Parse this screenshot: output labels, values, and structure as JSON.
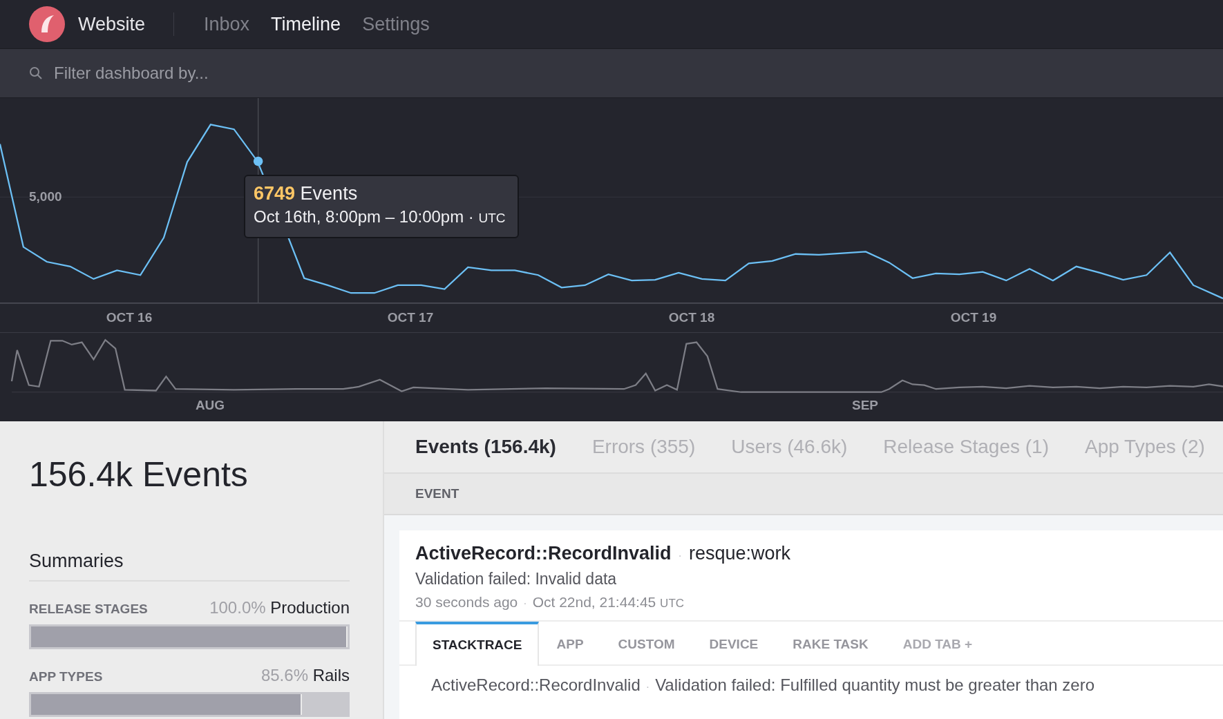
{
  "app_bar": {
    "project": "Website",
    "nav": [
      {
        "label": "Inbox",
        "selected": false
      },
      {
        "label": "Timeline",
        "selected": true
      },
      {
        "label": "Settings",
        "selected": false
      }
    ]
  },
  "filter": {
    "placeholder": "Filter dashboard by..."
  },
  "timeline_chart": {
    "y_label": "5,000",
    "x_labels": [
      "OCT 16",
      "OCT 17",
      "OCT 18",
      "OCT 19"
    ],
    "tooltip": {
      "count": "6749",
      "unit": "Events",
      "range": "Oct 16th, 8:00pm – 10:00pm ·",
      "timezone": "UTC"
    }
  },
  "overview_chart": {
    "x_labels": [
      "AUG",
      "SEP"
    ]
  },
  "summary": {
    "title": "156.4k Events",
    "heading": "Summaries",
    "rows": [
      {
        "label": "RELEASE STAGES",
        "percent": "100.0%",
        "value": "Production",
        "level": 1.0
      },
      {
        "label": "APP TYPES",
        "percent": "85.6%",
        "value": "Rails",
        "level": 0.856
      }
    ]
  },
  "tabs": [
    {
      "label": "Events (156.4k)",
      "selected": true
    },
    {
      "label": "Errors (355)",
      "selected": false
    },
    {
      "label": "Users (46.6k)",
      "selected": false
    },
    {
      "label": "Release Stages (1)",
      "selected": false
    },
    {
      "label": "App Types (2)",
      "selected": false
    }
  ],
  "table": {
    "column": "EVENT"
  },
  "event": {
    "separator": "·",
    "error_class": "ActiveRecord::RecordInvalid",
    "context": "resque:work",
    "message": "Validation failed: Invalid data",
    "age": "30 seconds ago",
    "timestamp": "Oct 22nd, 21:44:45",
    "timezone": "UTC",
    "tabs": [
      {
        "label": "STACKTRACE",
        "kind": "tab",
        "selected": true
      },
      {
        "label": "APP",
        "kind": "tab",
        "selected": false
      },
      {
        "label": "CUSTOM",
        "kind": "tab",
        "selected": false
      },
      {
        "label": "DEVICE",
        "kind": "tab",
        "selected": false
      },
      {
        "label": "RAKE TASK",
        "kind": "tab",
        "selected": false
      },
      {
        "label": "ADD TAB +",
        "kind": "add",
        "selected": false
      }
    ],
    "stacktrace": {
      "error_class": "ActiveRecord::RecordInvalid",
      "message": "Validation failed: Fulfilled quantity must be greater than zero"
    }
  }
}
